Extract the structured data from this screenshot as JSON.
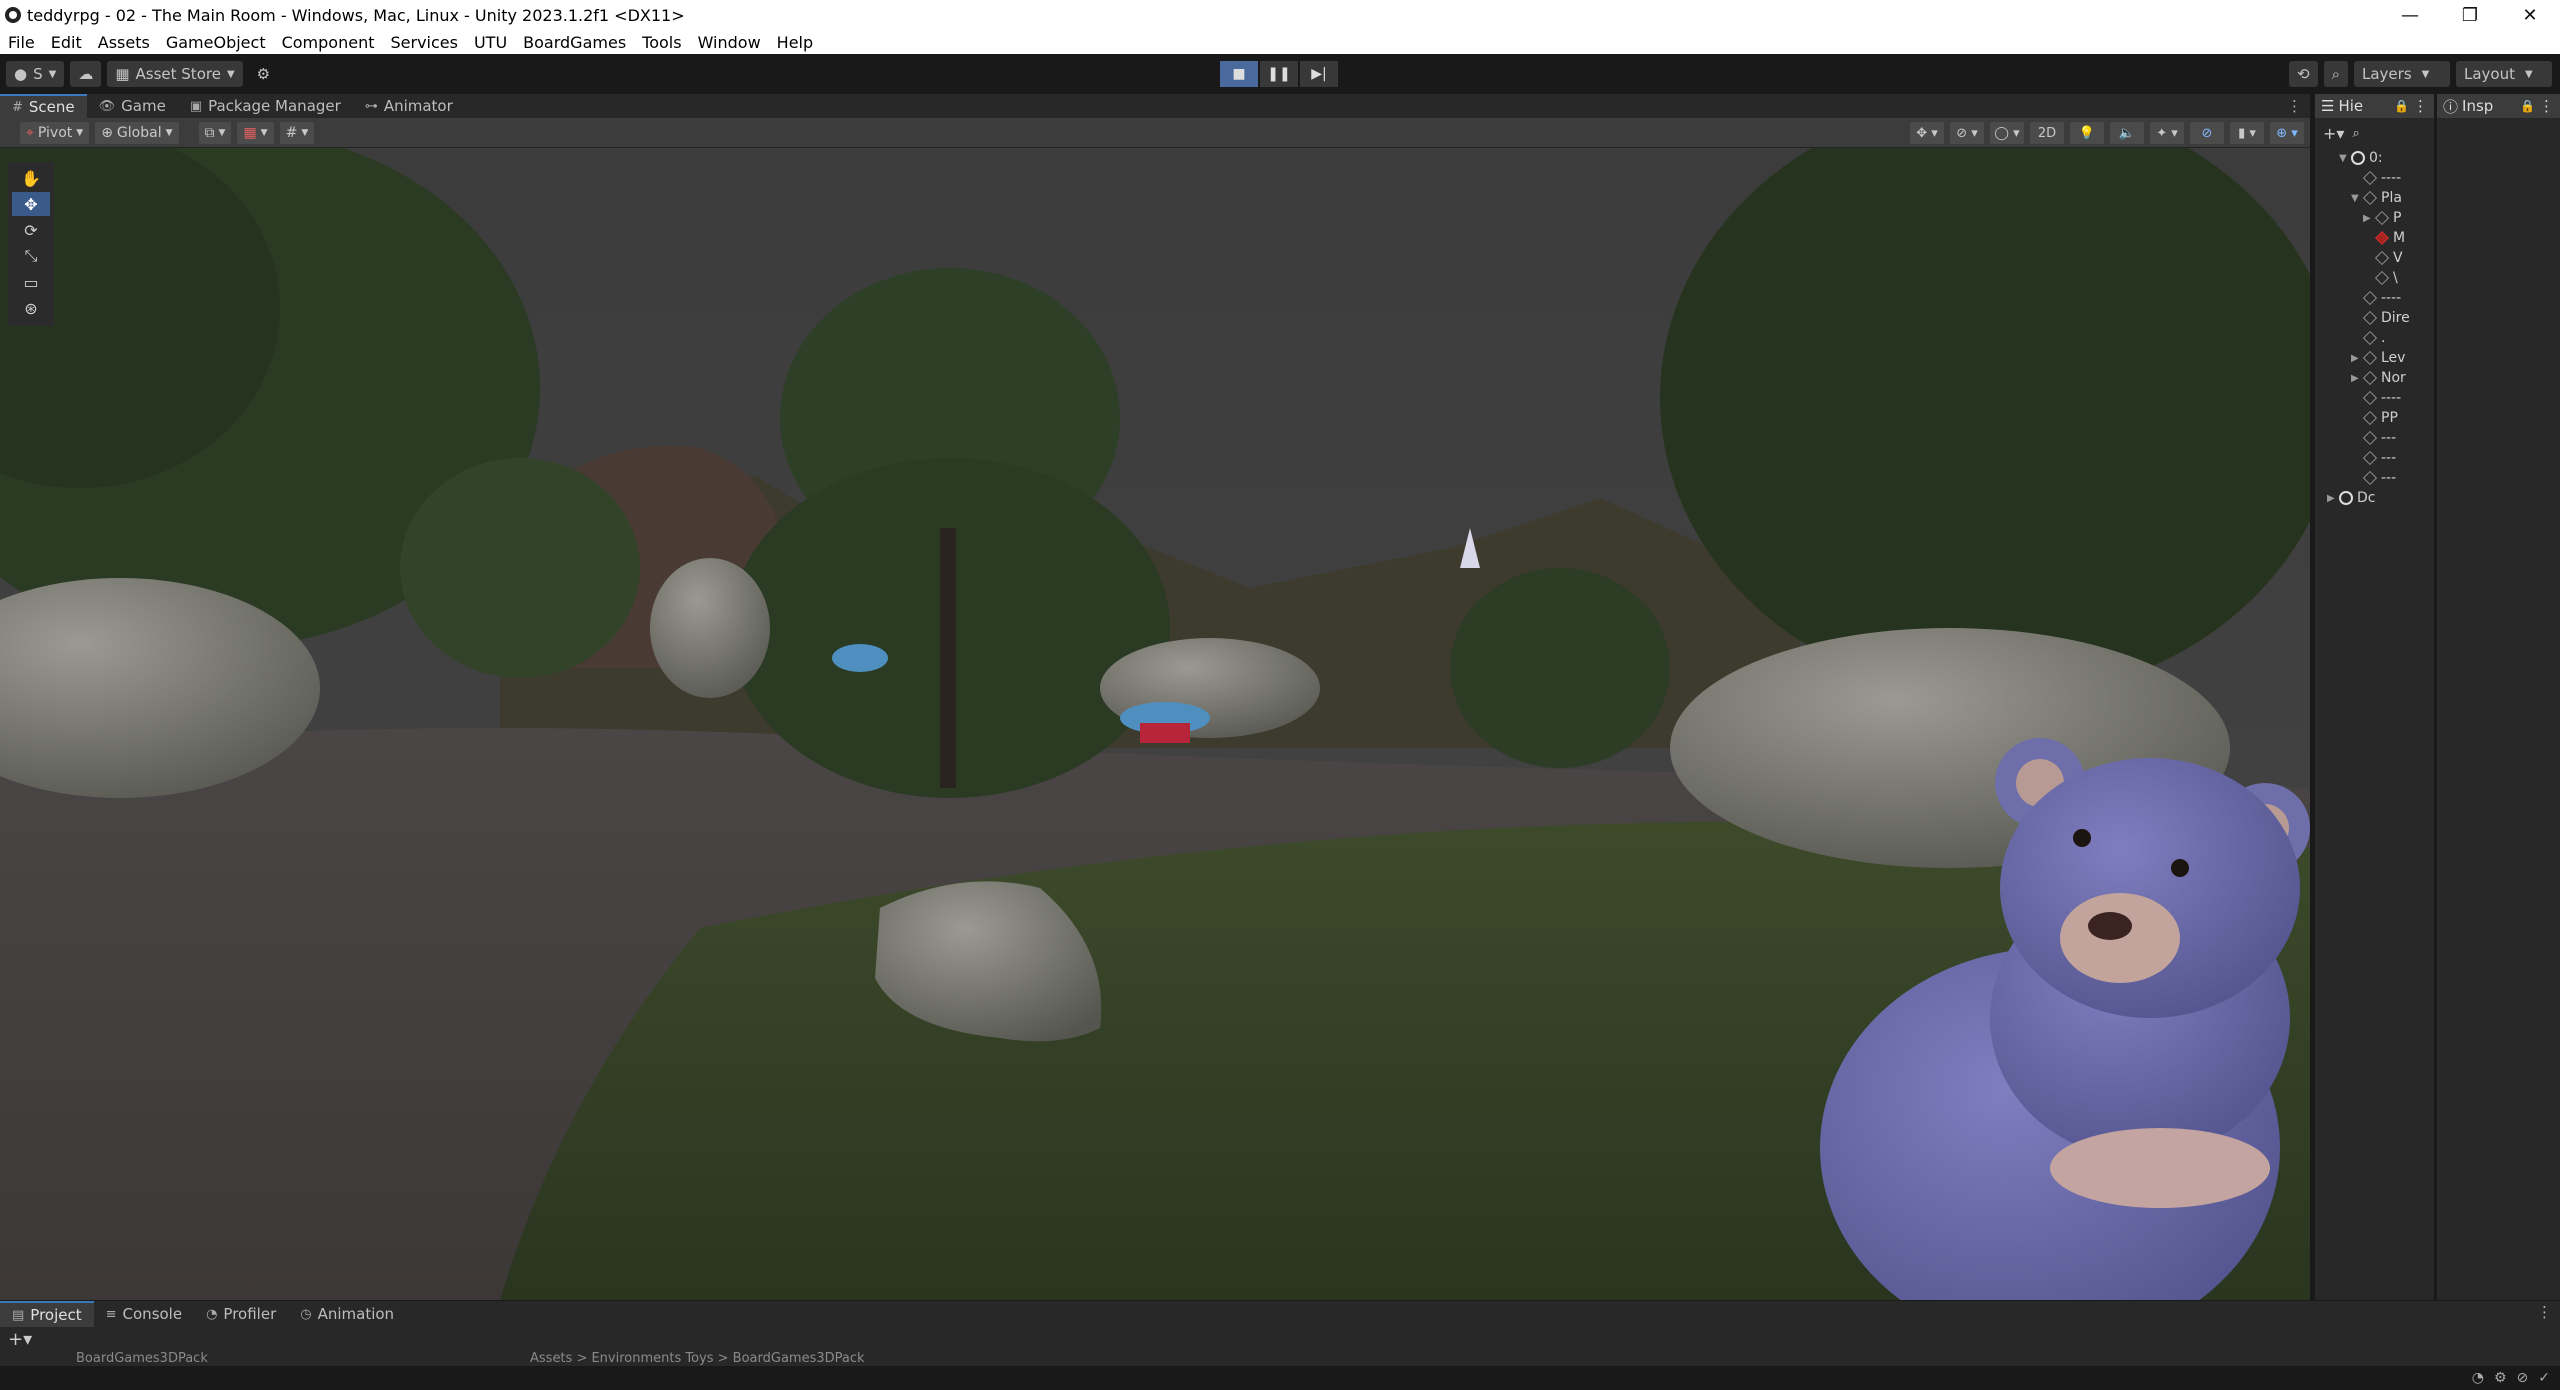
{
  "window": {
    "title": "teddyrpg - 02 - The Main Room - Windows, Mac, Linux - Unity 2023.1.2f1 <DX11>",
    "minimize": "—",
    "maximize": "❐",
    "close": "✕"
  },
  "menu": [
    "File",
    "Edit",
    "Assets",
    "GameObject",
    "Component",
    "Services",
    "UTU",
    "BoardGames",
    "Tools",
    "Window",
    "Help"
  ],
  "toolbar": {
    "account_label": "S",
    "asset_store_label": "Asset Store",
    "layers_label": "Layers",
    "layout_label": "Layout"
  },
  "scene_tabs": [
    {
      "label": "Scene",
      "icon": "#"
    },
    {
      "label": "Game",
      "icon": "👁"
    },
    {
      "label": "Package Manager",
      "icon": "▣"
    },
    {
      "label": "Animator",
      "icon": "⊶"
    }
  ],
  "scene_toolbar": {
    "pivot_label": "Pivot",
    "global_label": "Global",
    "mode_2d_label": "2D"
  },
  "hierarchy": {
    "tab_label": "Hie",
    "rows": [
      {
        "label": "0:",
        "kind": "scene",
        "indent": 2,
        "arrow": "▼"
      },
      {
        "label": "----",
        "kind": "object",
        "indent": 3,
        "arrow": ""
      },
      {
        "label": "Pla",
        "kind": "object",
        "indent": 3,
        "arrow": "▼"
      },
      {
        "label": "P",
        "kind": "object",
        "indent": 4,
        "arrow": "▶"
      },
      {
        "label": "M",
        "kind": "red",
        "indent": 4,
        "arrow": ""
      },
      {
        "label": "V",
        "kind": "object",
        "indent": 4,
        "arrow": ""
      },
      {
        "label": "\\",
        "kind": "object",
        "indent": 4,
        "arrow": ""
      },
      {
        "label": "----",
        "kind": "object",
        "indent": 3,
        "arrow": ""
      },
      {
        "label": "Dire",
        "kind": "object",
        "indent": 3,
        "arrow": ""
      },
      {
        "label": ".",
        "kind": "object",
        "indent": 3,
        "arrow": ""
      },
      {
        "label": "Lev",
        "kind": "object",
        "indent": 3,
        "arrow": "▶"
      },
      {
        "label": "Nor",
        "kind": "object",
        "indent": 3,
        "arrow": "▶"
      },
      {
        "label": "----",
        "kind": "object",
        "indent": 3,
        "arrow": ""
      },
      {
        "label": "PP",
        "kind": "object",
        "indent": 3,
        "arrow": ""
      },
      {
        "label": "---",
        "kind": "object",
        "indent": 3,
        "arrow": ""
      },
      {
        "label": "---",
        "kind": "object",
        "indent": 3,
        "arrow": ""
      },
      {
        "label": "---",
        "kind": "object",
        "indent": 3,
        "arrow": ""
      },
      {
        "label": "Dc",
        "kind": "scene",
        "indent": 1,
        "arrow": "▶"
      }
    ]
  },
  "inspector": {
    "tab_label": "Insp"
  },
  "bottom_tabs": [
    {
      "label": "Project",
      "icon": "▤"
    },
    {
      "label": "Console",
      "icon": "≡"
    },
    {
      "label": "Profiler",
      "icon": "◔"
    },
    {
      "label": "Animation",
      "icon": "◷"
    }
  ],
  "project": {
    "folder_label": "BoardGames3DPack",
    "breadcrumb": "Assets > Environments Toys > BoardGames3DPack"
  },
  "colors": {
    "accent": "#3a79bb",
    "panel": "#282828",
    "toolbar": "#191919"
  }
}
